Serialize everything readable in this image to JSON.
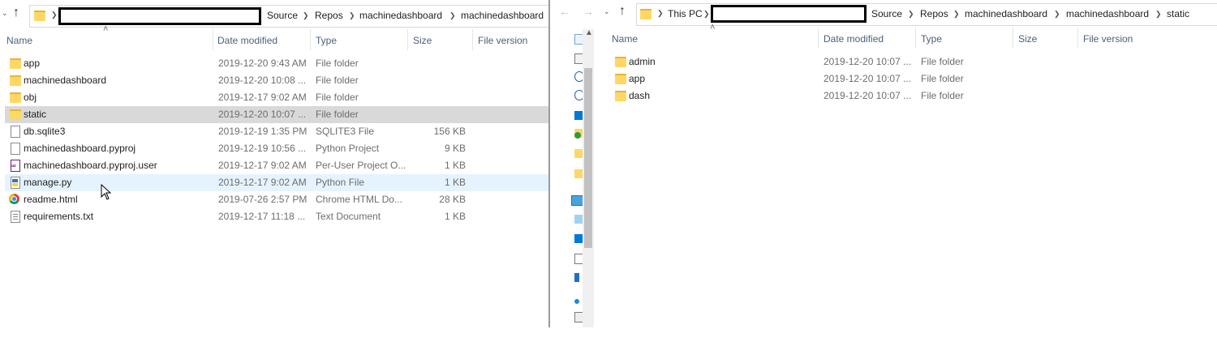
{
  "left": {
    "breadcrumb": [
      "Source",
      "Repos",
      "machinedashboard",
      "machinedashboard"
    ],
    "columns": [
      "Name",
      "Date modified",
      "Type",
      "Size",
      "File version"
    ],
    "files": [
      {
        "name": "app",
        "date": "2019-12-20 9:43 AM",
        "type": "File folder",
        "size": "",
        "icon": "folder-icon"
      },
      {
        "name": "machinedashboard",
        "date": "2019-12-20 10:08 ...",
        "type": "File folder",
        "size": "",
        "icon": "folder-icon"
      },
      {
        "name": "obj",
        "date": "2019-12-17 9:02 AM",
        "type": "File folder",
        "size": "",
        "icon": "folder-icon"
      },
      {
        "name": "static",
        "date": "2019-12-20 10:07 ...",
        "type": "File folder",
        "size": "",
        "icon": "folder-icon"
      },
      {
        "name": "db.sqlite3",
        "date": "2019-12-19 1:35 PM",
        "type": "SQLITE3 File",
        "size": "156 KB",
        "icon": "file-icon"
      },
      {
        "name": "machinedashboard.pyproj",
        "date": "2019-12-19 10:56 ...",
        "type": "Python Project",
        "size": "9 KB",
        "icon": "file-icon"
      },
      {
        "name": "machinedashboard.pyproj.user",
        "date": "2019-12-17 9:02 AM",
        "type": "Per-User Project O...",
        "size": "1 KB",
        "icon": "visual-studio-file-icon"
      },
      {
        "name": "manage.py",
        "date": "2019-12-17 9:02 AM",
        "type": "Python File",
        "size": "1 KB",
        "icon": "python-file-icon"
      },
      {
        "name": "readme.html",
        "date": "2019-07-26 2:57 PM",
        "type": "Chrome HTML Do...",
        "size": "28 KB",
        "icon": "chrome-icon"
      },
      {
        "name": "requirements.txt",
        "date": "2019-12-17 11:18 ...",
        "type": "Text Document",
        "size": "1 KB",
        "icon": "text-file-icon"
      }
    ],
    "selected_index": 3,
    "hover_index": 7
  },
  "right": {
    "breadcrumb": [
      "This PC",
      "Source",
      "Repos",
      "machinedashboard",
      "machinedashboard",
      "static"
    ],
    "columns": [
      "Name",
      "Date modified",
      "Type",
      "Size",
      "File version"
    ],
    "files": [
      {
        "name": "admin",
        "date": "2019-12-20 10:07 ...",
        "type": "File folder",
        "icon": "folder-icon"
      },
      {
        "name": "app",
        "date": "2019-12-20 10:07 ...",
        "type": "File folder",
        "icon": "folder-icon"
      },
      {
        "name": "dash",
        "date": "2019-12-20 10:07 ...",
        "type": "File folder",
        "icon": "folder-icon"
      }
    ]
  },
  "colors": {
    "selected_row": "#d9d9d9",
    "hover_row": "#e5f3ff",
    "header_text": "#4c607a",
    "folder": "#ffd766"
  }
}
